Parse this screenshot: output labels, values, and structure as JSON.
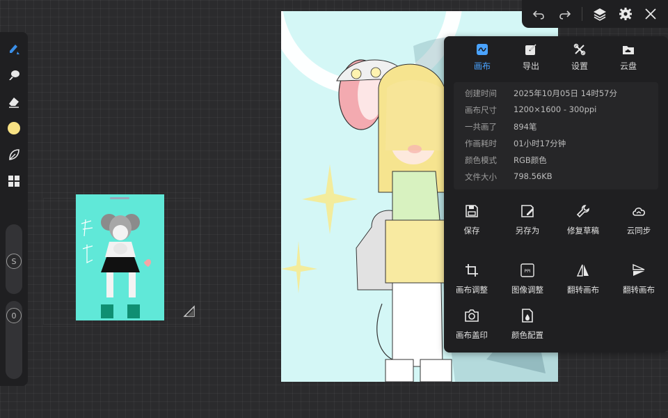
{
  "toolbar": {
    "tools": [
      {
        "icon": "brush-icon"
      },
      {
        "icon": "smudge-icon"
      },
      {
        "icon": "eraser-icon"
      },
      {
        "icon": "color-swatch",
        "color": "#f7e183"
      },
      {
        "icon": "leaf-icon"
      },
      {
        "icon": "grid-icon"
      }
    ],
    "size_label": "S",
    "opacity_label": "0"
  },
  "topbar": {
    "buttons": [
      "undo-icon",
      "redo-icon",
      "layers-icon",
      "gear-icon",
      "close-icon"
    ]
  },
  "panel": {
    "tabs": [
      {
        "label": "画布",
        "icon": "canvas-icon",
        "active": true
      },
      {
        "label": "导出",
        "icon": "export-icon",
        "active": false
      },
      {
        "label": "设置",
        "icon": "tools-icon",
        "active": false
      },
      {
        "label": "云盘",
        "icon": "cloud-drive-icon",
        "active": false
      }
    ],
    "info": [
      {
        "key": "创建时间",
        "value": "2025年10月05日 14时57分"
      },
      {
        "key": "画布尺寸",
        "value": "1200×1600 - 300ppi"
      },
      {
        "key": "一共画了",
        "value": "894笔"
      },
      {
        "key": "作画耗时",
        "value": "01小时17分钟"
      },
      {
        "key": "颜色模式",
        "value": "RGB颜色"
      },
      {
        "key": "文件大小",
        "value": "798.56KB"
      }
    ],
    "actions_row1": [
      "保存",
      "另存为",
      "修复草稿",
      "云同步"
    ],
    "actions_row2": [
      "画布调整",
      "图像调整",
      "翻转画布",
      "翻转画布"
    ],
    "actions_row3": [
      "画布盖印",
      "颜色配置"
    ],
    "image_adjust_badge": "PPI"
  },
  "colors": {
    "accent": "#4aa3ff",
    "panel_bg": "#1f1f21",
    "canvas_bg": "#d9f7f7",
    "thumb_bg": "#60e8d8"
  }
}
